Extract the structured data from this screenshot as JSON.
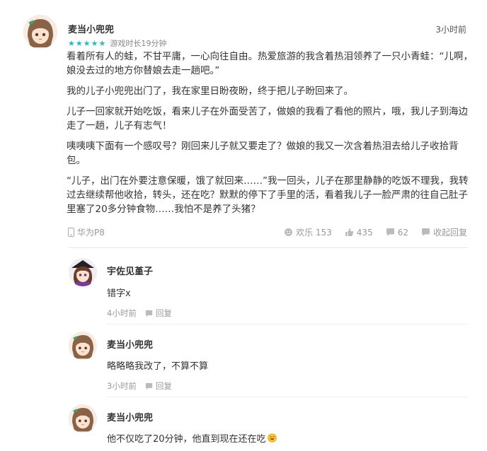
{
  "post": {
    "author": "麦当小兜兜",
    "time": "3小时前",
    "rating_stars": 5,
    "playtime": "游戏时长19分钟",
    "paragraphs": [
      "看着所有人的蛙，不甘平庸，一心向往自由。热爱旅游的我含着热泪领养了一只小青蛙：“儿啊，娘没去过的地方你替娘去走一趟吧。”",
      "我的儿子小兜兜出门了，我在家里日盼夜盼，终于把儿子盼回来了。",
      "儿子一回家就开始吃饭，看来儿子在外面受苦了，做娘的我看了看他的照片，哦，我儿子到海边走了一趟，儿子有志气！",
      "咦咦咦下面有一个感叹号？刚回来儿子就又要走了？做娘的我又一次含着热泪去给儿子收拾背包。",
      "“儿子，出门在外要注意保暖，饿了就回来……”我一回头，儿子在那里静静的吃饭不理我，我转过去继续帮他收拾，转头，还在吃？默默的停下了手里的活，看着我儿子一脸严肃的往自己肚子里塞了20多分钟食物……我怕不是养了头猪？"
    ],
    "device": "华为P8",
    "actions": {
      "happy_label": "欢乐 153",
      "like_count": "435",
      "comment_count": "62",
      "collapse_label": "收起回复"
    }
  },
  "replies": [
    {
      "author": "宇佐见堇子",
      "text": "错字x",
      "time": "4小时前",
      "reply_label": "回复"
    },
    {
      "author": "麦当小兜兜",
      "text": "略略略我改了，不算不算",
      "time": "3小时前",
      "reply_label": "回复"
    },
    {
      "author": "麦当小兜兜",
      "text": "他不仅吃了20分钟，他直到现在还在吃",
      "emoji": "smile-emoji"
    }
  ],
  "colors": {
    "accent": "#2cb6c0",
    "muted": "#999999",
    "text": "#333333"
  }
}
